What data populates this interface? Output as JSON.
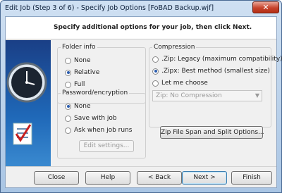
{
  "window": {
    "title": "Edit Job (Step 3 of 6) - Specify Job Options [FoBAD Backup.wjf]",
    "close_glyph": "✕"
  },
  "header": {
    "instruction": "Specify additional options for your job, then click Next."
  },
  "folder_info": {
    "label": "Folder info",
    "options": [
      {
        "label": "None",
        "selected": false
      },
      {
        "label": "Relative",
        "selected": true
      },
      {
        "label": "Full",
        "selected": false
      }
    ]
  },
  "password": {
    "label": "Password/encryption",
    "options": [
      {
        "label": "None",
        "selected": true
      },
      {
        "label": "Save with job",
        "selected": false
      },
      {
        "label": "Ask when job runs",
        "selected": false
      }
    ],
    "edit_settings_label": "Edit settings..."
  },
  "compression": {
    "label": "Compression",
    "options": [
      {
        "label": ".Zip: Legacy (maximum compatibility)",
        "selected": false
      },
      {
        "label": ".Zipx: Best method (smallest size)",
        "selected": true
      },
      {
        "label": "Let me choose",
        "selected": false
      }
    ],
    "method_select_value": "Zip: No Compression"
  },
  "span_split_button": "Zip File Span and Split Options...",
  "footer": {
    "close": "Close",
    "help": "Help",
    "back": "< Back",
    "next": "Next >",
    "finish": "Finish"
  },
  "icons": {
    "clock": "clock-icon",
    "checklist": "checklist-document-icon",
    "dropdown": "chevron-down-icon"
  }
}
